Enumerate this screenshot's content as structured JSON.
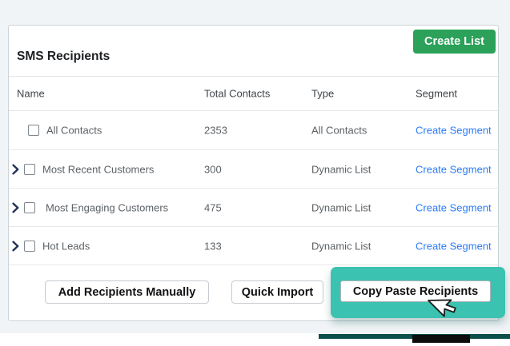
{
  "card": {
    "title": "SMS Recipients",
    "create_list_label": "Create List"
  },
  "table": {
    "headers": {
      "name": "Name",
      "total": "Total Contacts",
      "type": "Type",
      "segment": "Segment"
    },
    "rows": [
      {
        "name": "All Contacts",
        "total": "2353",
        "type": "All Contacts",
        "segment_link": "Create Segment"
      },
      {
        "name": "Most Recent Customers",
        "total": "300",
        "type": "Dynamic List",
        "segment_link": "Create Segment"
      },
      {
        "name": "Most Engaging Customers",
        "total": "475",
        "type": "Dynamic List",
        "segment_link": "Create Segment"
      },
      {
        "name": "Hot Leads",
        "total": "133",
        "type": "Dynamic List",
        "segment_link": "Create Segment"
      }
    ]
  },
  "footer": {
    "add_manually_label": "Add Recipients Manually",
    "quick_import_label": "Quick Import",
    "copy_paste_label": "Copy Paste Recipients"
  },
  "colors": {
    "accent_green": "#2ba15a",
    "link_blue": "#2b7cf7",
    "highlight_teal": "#3bc2b1",
    "dark_teal": "#0b4f4b",
    "page_bg": "#f1f4f7"
  }
}
